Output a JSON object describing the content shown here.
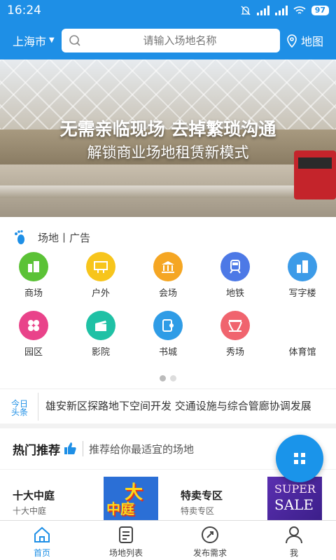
{
  "status": {
    "time": "16:24",
    "battery": "97"
  },
  "header": {
    "city": "上海市",
    "search_placeholder": "请输入场地名称",
    "map_label": "地图"
  },
  "banner": {
    "title": "无需亲临现场  去掉繁琐沟通",
    "subtitle": "解锁商业场地租赁新模式"
  },
  "categories": {
    "tab_label": "场地丨广告",
    "items": [
      {
        "label": "商场",
        "icon": "mall-icon",
        "color": "#5bc236"
      },
      {
        "label": "户外",
        "icon": "billboard-icon",
        "color": "#f7c51c"
      },
      {
        "label": "会场",
        "icon": "venue-icon",
        "color": "#f5a623"
      },
      {
        "label": "地铁",
        "icon": "subway-icon",
        "color": "#4d79e6"
      },
      {
        "label": "写字楼",
        "icon": "office-icon",
        "color": "#3c9be8"
      },
      {
        "label": "园区",
        "icon": "park-icon",
        "color": "#e9438a"
      },
      {
        "label": "影院",
        "icon": "cinema-icon",
        "color": "#1fc1a5"
      },
      {
        "label": "书城",
        "icon": "bookstore-icon",
        "color": "#2f9ce6"
      },
      {
        "label": "秀场",
        "icon": "stage-icon",
        "color": "#f0646e"
      },
      {
        "label": "体育馆",
        "icon": "",
        "color": ""
      }
    ]
  },
  "news": {
    "text": "雄安新区探路地下空间开发 交通设施与综合管廊协调发展"
  },
  "hot": {
    "title": "热门推荐",
    "desc": "推荐给你最适宜的场地"
  },
  "cards": [
    {
      "title": "十大中庭",
      "subtitle": "十大中庭",
      "img_big": "大",
      "img_small": "中庭"
    },
    {
      "title": "特卖专区",
      "subtitle": "特卖专区",
      "img_line1": "SUPER",
      "img_line2": "SALE"
    }
  ],
  "tabs": [
    {
      "label": "首页",
      "icon": "home-icon",
      "active": true
    },
    {
      "label": "场地列表",
      "icon": "list-icon",
      "active": false
    },
    {
      "label": "发布需求",
      "icon": "publish-icon",
      "active": false
    },
    {
      "label": "我",
      "icon": "profile-icon",
      "active": false
    }
  ]
}
